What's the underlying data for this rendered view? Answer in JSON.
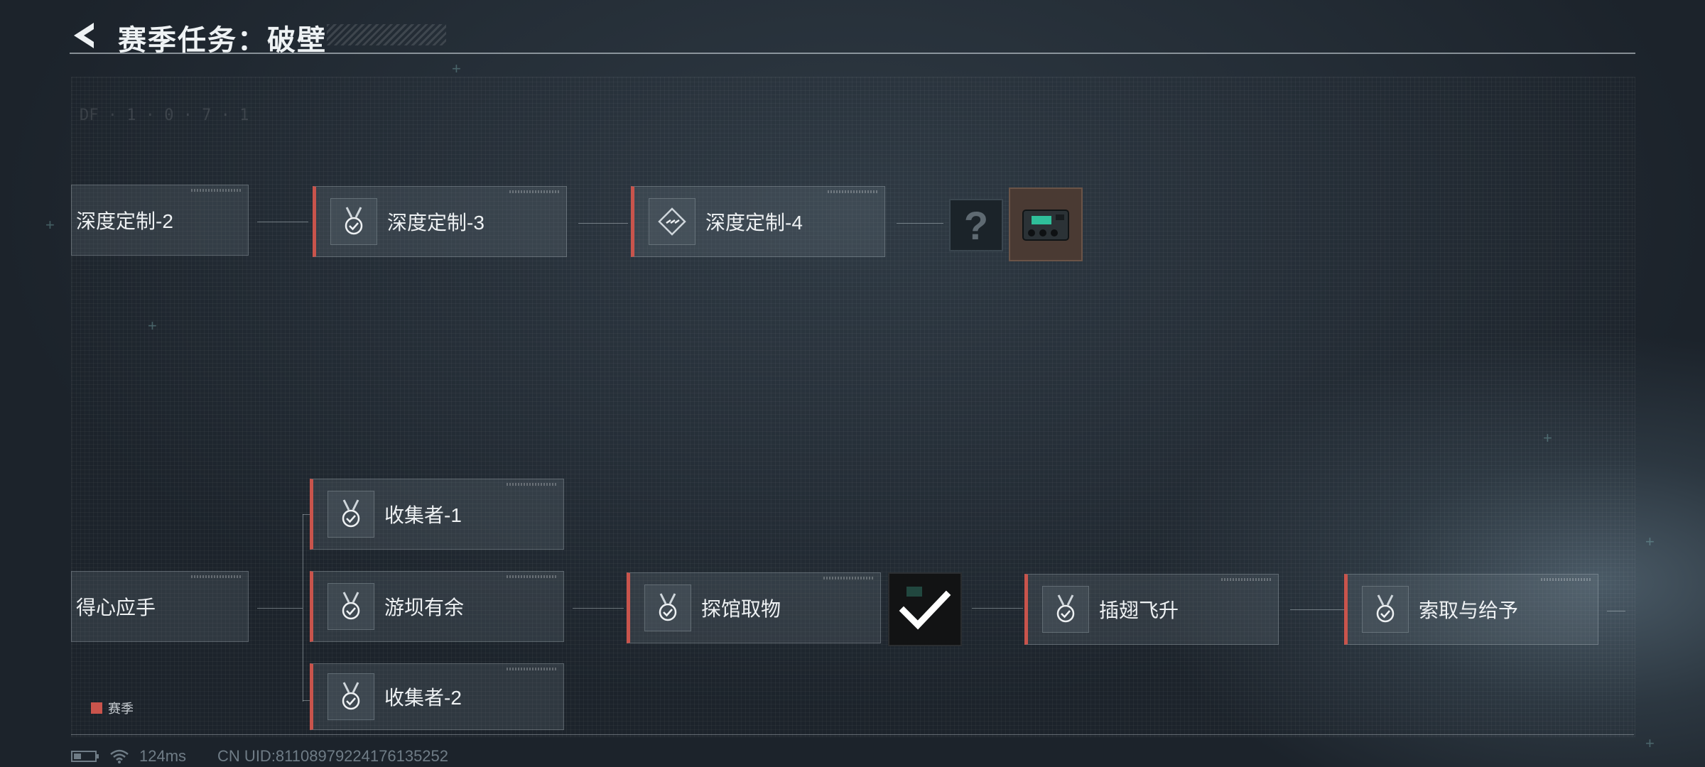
{
  "header": {
    "title": "赛季任务：破壁"
  },
  "top_row": {
    "nodes": [
      {
        "label": "深度定制-2",
        "icon": "none"
      },
      {
        "label": "深度定制-3",
        "icon": "medal-check-icon"
      },
      {
        "label": "深度定制-4",
        "icon": "diamond-dots-icon"
      }
    ],
    "reward_unknown_symbol": "?",
    "reward_item_icon": "device-reward-icon"
  },
  "bottom_row": {
    "start_label": "得心应手",
    "branch_nodes": [
      {
        "label": "收集者-1",
        "icon": "medal-check-icon"
      },
      {
        "label": "游坝有余",
        "icon": "medal-check-icon"
      },
      {
        "label": "收集者-2",
        "icon": "medal-check-icon"
      }
    ],
    "next_nodes": [
      {
        "label": "探馆取物",
        "icon": "medal-check-icon"
      },
      {
        "label": "插翅飞升",
        "icon": "medal-check-icon"
      },
      {
        "label": "索取与给予",
        "icon": "medal-check-icon"
      }
    ],
    "completed_reward_icon": "checkmark-icon"
  },
  "legend": {
    "label": "赛季",
    "color": "#c9544c"
  },
  "status_bar": {
    "ping": "124ms",
    "uid": "CN UID:81108979224176135252"
  },
  "decor": {
    "code": "DF · 1 · 0 · 7 · 1"
  },
  "colors": {
    "accent": "#c9544c",
    "background": "#242d36"
  }
}
